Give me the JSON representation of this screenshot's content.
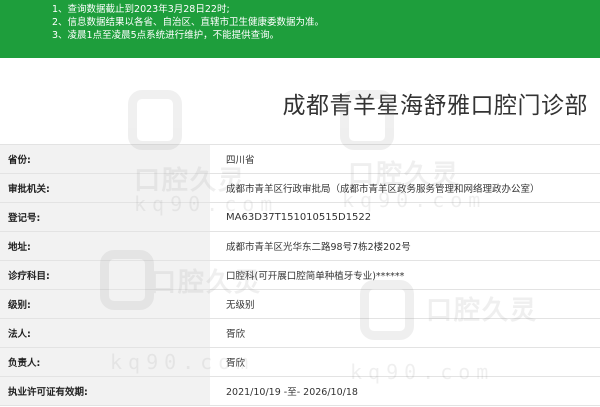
{
  "notice": {
    "lines": [
      "1、查询数据截止到2023年3月28日22时;",
      "2、信息数据结果以各省、自治区、直辖市卫生健康委数据为准。",
      "3、凌晨1点至凌晨5点系统进行维护，不能提供查询。"
    ]
  },
  "clinic": {
    "title": "成都青羊星海舒雅口腔门诊部"
  },
  "rows": [
    {
      "label": "省份:",
      "value": "四川省"
    },
    {
      "label": "审批机关:",
      "value": "成都市青羊区行政审批局（成都市青羊区政务服务管理和网络理政办公室）"
    },
    {
      "label": "登记号:",
      "value": "MA63D37T151010515D1522"
    },
    {
      "label": "地址:",
      "value": "成都市青羊区光华东二路98号7栋2楼202号"
    },
    {
      "label": "诊疗科目:",
      "value": "口腔科(可开展口腔简单种植牙专业)******"
    },
    {
      "label": "级别:",
      "value": "无级别"
    },
    {
      "label": "法人:",
      "value": "胥欣"
    },
    {
      "label": "负责人:",
      "value": "胥欣"
    },
    {
      "label": "执业许可证有效期:",
      "value": "2021/10/19 -至- 2026/10/18"
    }
  ],
  "watermark": {
    "text": "口腔久灵",
    "url": "kq90.com"
  }
}
